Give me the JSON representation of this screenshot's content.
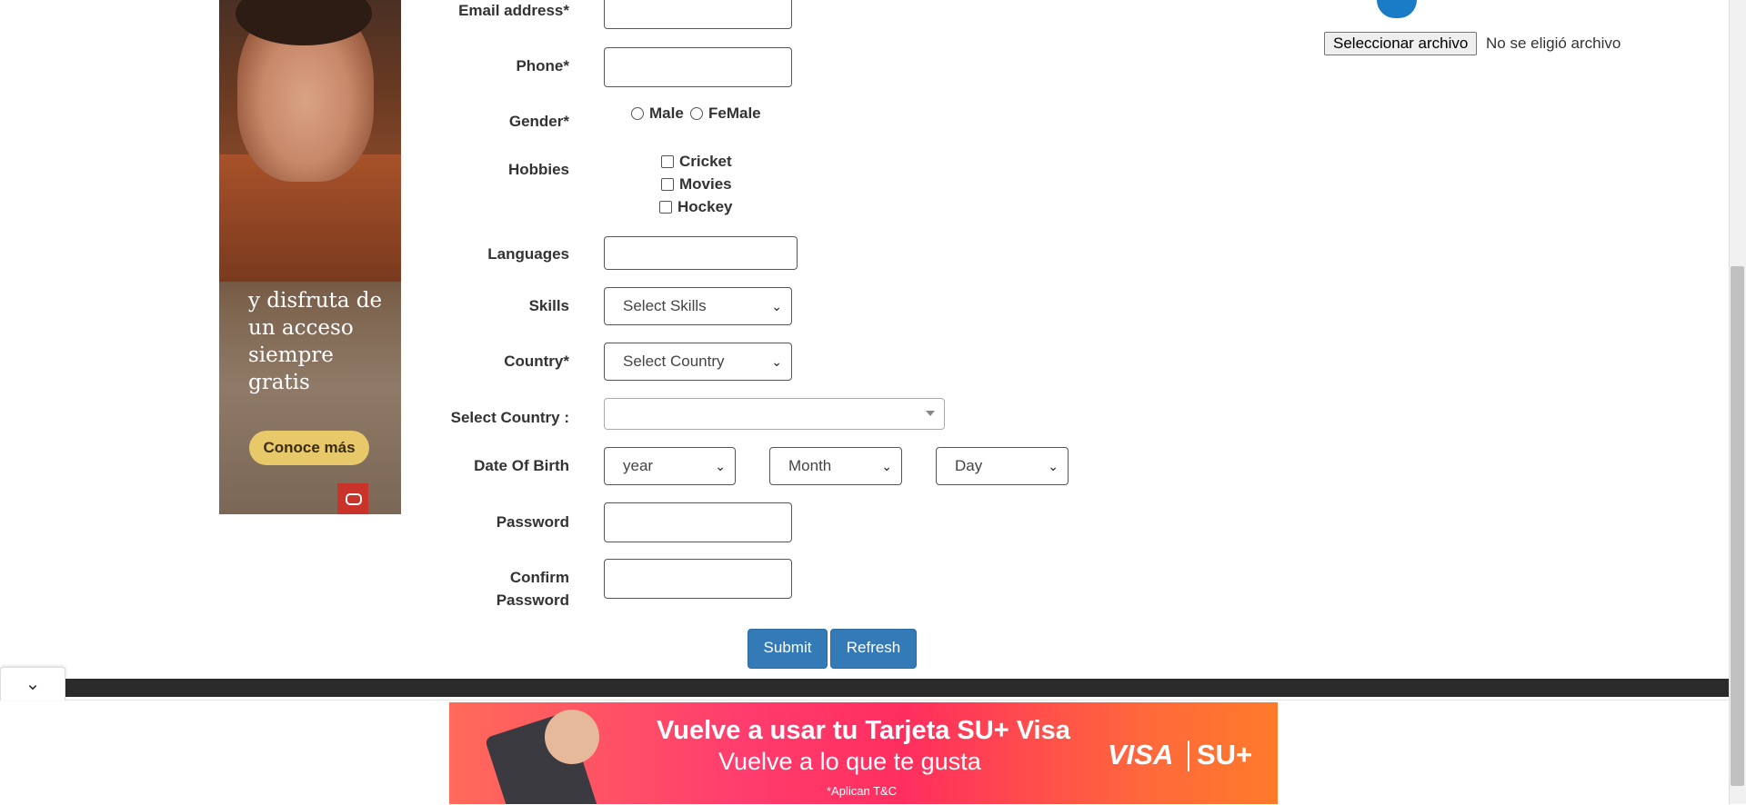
{
  "form": {
    "email_label": "Email address*",
    "phone_label": "Phone*",
    "gender_label": "Gender*",
    "gender_options": [
      "Male",
      "FeMale"
    ],
    "hobbies_label": "Hobbies",
    "hobbies_options": [
      "Cricket",
      "Movies",
      "Hockey"
    ],
    "languages_label": "Languages",
    "skills_label": "Skills",
    "skills_select": "Select Skills",
    "country_label": "Country*",
    "country_select": "Select Country",
    "select_country_label": "Select Country :",
    "select_country_value": "",
    "dob_label": "Date Of Birth",
    "dob_year": "year",
    "dob_month": "Month",
    "dob_day": "Day",
    "password_label": "Password",
    "confirm_password_label_line1": "Confirm",
    "confirm_password_label_line2": "Password",
    "submit_label": "Submit",
    "refresh_label": "Refresh"
  },
  "file_upload": {
    "button_label": "Seleccionar archivo",
    "status_text": "No se eligió archivo"
  },
  "left_ad": {
    "text": "y disfruta de un acceso siempre gratis",
    "cta": "Conoce más"
  },
  "bottom_ad": {
    "headline": "Vuelve a usar tu Tarjeta SU+ Visa",
    "subheadline": "Vuelve a lo que te gusta",
    "terms": "*Aplican T&C",
    "brand1": "VISA",
    "brand2": "SU+"
  },
  "colors": {
    "primary_button": "#337ab7",
    "footer": "#2b2b2b",
    "banner_pink": "#ff2e5f"
  },
  "icons": {
    "collapse": "chevron-down-icon",
    "select_arrow": "chevron-down-icon"
  }
}
